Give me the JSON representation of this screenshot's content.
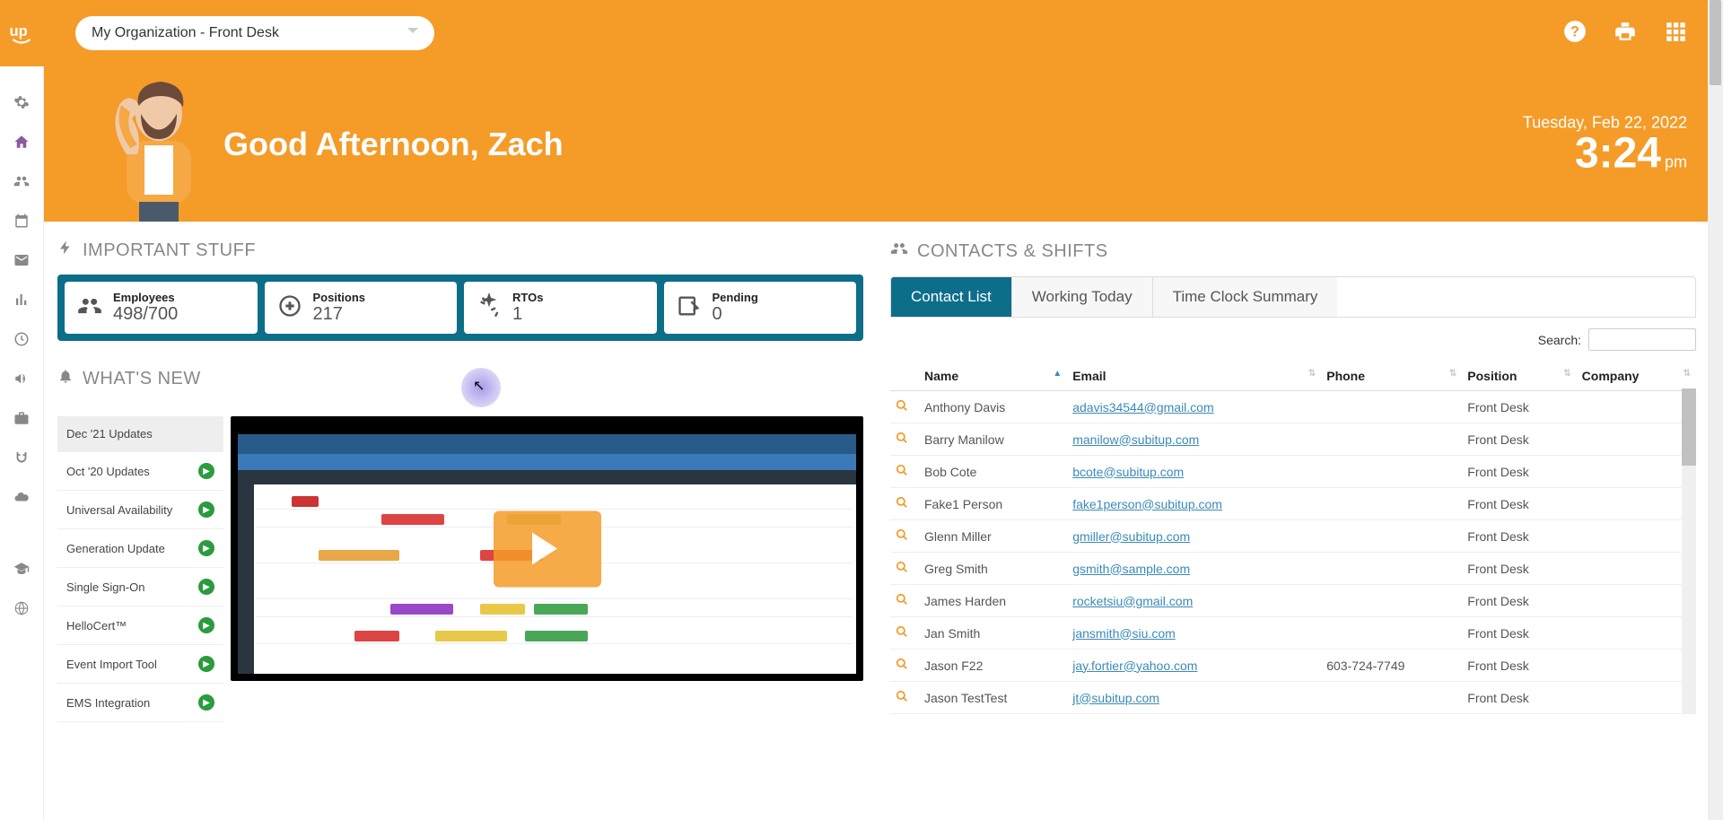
{
  "org_selector": "My Organization - Front Desk",
  "greeting": "Good Afternoon, Zach",
  "date": "Tuesday, Feb 22, 2022",
  "time": "3:24",
  "ampm": "pm",
  "sections": {
    "important": "IMPORTANT STUFF",
    "whatsnew": "WHAT'S NEW",
    "contacts": "CONTACTS & SHIFTS"
  },
  "stats": {
    "employees": {
      "label": "Employees",
      "value": "498/700"
    },
    "positions": {
      "label": "Positions",
      "value": "217"
    },
    "rtos": {
      "label": "RTOs",
      "value": "1"
    },
    "pending": {
      "label": "Pending",
      "value": "0"
    }
  },
  "whatsnew_items": [
    "Dec '21 Updates",
    "Oct '20 Updates",
    "Universal Availability",
    "Generation Update",
    "Single Sign-On",
    "HelloCert™",
    "Event Import Tool",
    "EMS Integration"
  ],
  "tabs": {
    "contact_list": "Contact List",
    "working_today": "Working Today",
    "time_clock": "Time Clock Summary"
  },
  "search_label": "Search:",
  "table": {
    "headers": {
      "name": "Name",
      "email": "Email",
      "phone": "Phone",
      "position": "Position",
      "company": "Company"
    },
    "rows": [
      {
        "name": "Anthony Davis",
        "email": "adavis34544@gmail.com",
        "phone": "",
        "position": "Front Desk"
      },
      {
        "name": "Barry Manilow",
        "email": "manilow@subitup.com",
        "phone": "",
        "position": "Front Desk"
      },
      {
        "name": "Bob Cote",
        "email": "bcote@subitup.com",
        "phone": "",
        "position": "Front Desk"
      },
      {
        "name": "Fake1 Person",
        "email": "fake1person@subitup.com",
        "phone": "",
        "position": "Front Desk"
      },
      {
        "name": "Glenn Miller",
        "email": "gmiller@subitup.com",
        "phone": "",
        "position": "Front Desk"
      },
      {
        "name": "Greg Smith",
        "email": "gsmith@sample.com",
        "phone": "",
        "position": "Front Desk"
      },
      {
        "name": "James Harden",
        "email": "rocketsiu@gmail.com",
        "phone": "",
        "position": "Front Desk"
      },
      {
        "name": "Jan Smith",
        "email": "jansmith@siu.com",
        "phone": "",
        "position": "Front Desk"
      },
      {
        "name": "Jason F22",
        "email": "jay.fortier@yahoo.com",
        "phone": "603-724-7749",
        "position": "Front Desk"
      },
      {
        "name": "Jason TestTest",
        "email": "jt@subitup.com",
        "phone": "",
        "position": "Front Desk"
      }
    ]
  }
}
